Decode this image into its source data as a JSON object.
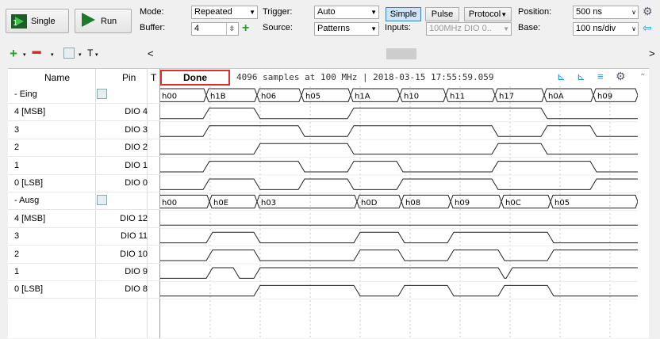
{
  "toolbar": {
    "single_label": "Single",
    "run_label": "Run",
    "mode_label": "Mode:",
    "mode_value": "Repeated",
    "buffer_label": "Buffer:",
    "buffer_value": "4",
    "trigger_label": "Trigger:",
    "trigger_value": "Auto",
    "source_label": "Source:",
    "source_value": "Patterns",
    "simple_label": "Simple",
    "pulse_label": "Pulse",
    "protocol_label": "Protocol",
    "inputs_label": "Inputs:",
    "inputs_value": "100MHz DIO 0..",
    "position_label": "Position:",
    "position_value": "500 ns",
    "base_label": "Base:",
    "base_value": "100 ns/div"
  },
  "second_bar": {
    "add_icon": "plus-icon",
    "remove_icon": "minus-icon",
    "edit_icon": "edit-icon",
    "text_icon": "T",
    "left_arrow": "<",
    "right_arrow": ">"
  },
  "table": {
    "col_name": "Name",
    "col_pin": "Pin",
    "col_t": "T",
    "status": "Done",
    "info": "4096 samples at 100 MHz | 2018-03-15 17:55:59.059"
  },
  "rows": [
    {
      "name": "- Eing",
      "pin": "",
      "bus": true
    },
    {
      "name": "4 [MSB]",
      "pin": "DIO 4"
    },
    {
      "name": "3",
      "pin": "DIO 3"
    },
    {
      "name": "2",
      "pin": "DIO 2"
    },
    {
      "name": "1",
      "pin": "DIO 1"
    },
    {
      "name": "0 [LSB]",
      "pin": "DIO 0"
    },
    {
      "name": "- Ausg",
      "pin": "",
      "bus": true
    },
    {
      "name": "4 [MSB]",
      "pin": "DIO 12"
    },
    {
      "name": "3",
      "pin": "DIO 11"
    },
    {
      "name": "2",
      "pin": "DIO 10"
    },
    {
      "name": "1",
      "pin": "DIO 9"
    },
    {
      "name": "0 [LSB]",
      "pin": "DIO 8"
    }
  ],
  "bus_eing": [
    "h00",
    "h1B",
    "h06",
    "h05",
    "h1A",
    "h10",
    "h11",
    "h17",
    "h0A",
    "h09"
  ],
  "bus_ausg": [
    "h00",
    "h0E",
    "h03",
    "h0D",
    "h08",
    "h09",
    "h0C",
    "h05"
  ],
  "colors": {
    "accent_border": "#d8302f",
    "active_button": "#cfe5f7",
    "grid_line": "#c0c0c0"
  }
}
